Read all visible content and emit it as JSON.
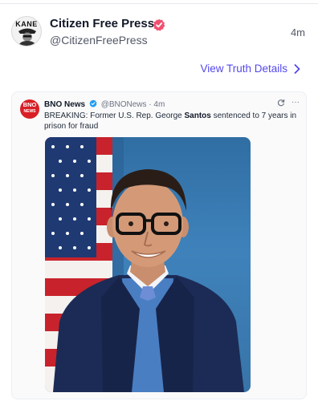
{
  "post": {
    "avatar_text": "KANE",
    "display_name": "Citizen Free Press",
    "handle": "@CitizenFreePress",
    "time_ago": "4m",
    "badge_color": "#f0506e"
  },
  "details_link": {
    "label": "View Truth Details",
    "icon": "chevron-right-icon",
    "color": "#5448ee"
  },
  "embedded_tweet": {
    "logo_line1": "BNO",
    "logo_line2": "NEWS",
    "account_name": "BNO News",
    "handle": "@BNONews",
    "separator": "·",
    "time_ago": "4m",
    "text_before": "BREAKING: Former U.S. Rep. George ",
    "text_bold": "Santos",
    "text_after": " sentenced to 7 years in prison for fraud",
    "more_label": "···",
    "image_alt": "Portrait of a man in a navy suit in front of an American flag",
    "verified_color": "#1d9bf0"
  }
}
